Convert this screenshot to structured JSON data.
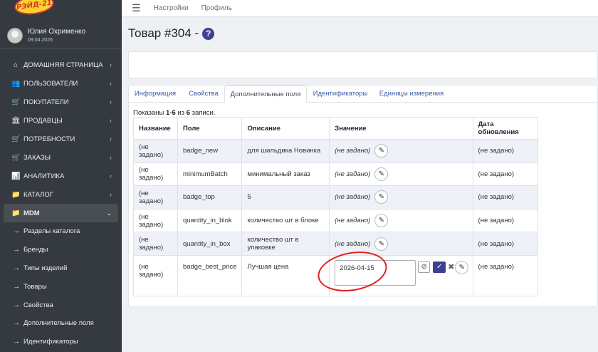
{
  "brand": {
    "logo_text": "РЭЙД-21"
  },
  "user": {
    "name": "Юлия Охрименко",
    "date": "09.04.2026"
  },
  "nav": [
    {
      "icon": "home-icon",
      "glyph": "⌂",
      "label": "ДОМАШНЯЯ СТРАНИЦА",
      "arrow": "‹"
    },
    {
      "icon": "users-icon",
      "glyph": "👥",
      "label": "ПОЛЬЗОВАТЕЛИ",
      "arrow": "‹"
    },
    {
      "icon": "cart-icon",
      "glyph": "🛒",
      "label": "ПОКУПАТЕЛИ",
      "arrow": "‹"
    },
    {
      "icon": "bank-icon",
      "glyph": "🏛",
      "label": "ПРОДАВЦЫ",
      "arrow": "‹"
    },
    {
      "icon": "cart-icon",
      "glyph": "🛒",
      "label": "ПОТРЕБНОСТИ",
      "arrow": "‹"
    },
    {
      "icon": "cart-icon",
      "glyph": "🛒",
      "label": "ЗАКАЗЫ",
      "arrow": "‹"
    },
    {
      "icon": "chart-icon",
      "glyph": "📊",
      "label": "АНАЛИТИКА",
      "arrow": "‹"
    },
    {
      "icon": "folder-icon",
      "glyph": "📁",
      "label": "КАТАЛОГ",
      "arrow": "‹"
    }
  ],
  "nav_active": {
    "icon": "folder-icon",
    "glyph": "📁",
    "label": "MDM",
    "arrow": "⌄"
  },
  "subnav": [
    {
      "label": "Разделы каталога"
    },
    {
      "label": "Бренды"
    },
    {
      "label": "Типы изделий"
    },
    {
      "label": "Товары"
    },
    {
      "label": "Свойства"
    },
    {
      "label": "Дополнительные поля"
    },
    {
      "label": "Идентификаторы"
    }
  ],
  "topbar": {
    "links": [
      "Настройки",
      "Профиль"
    ]
  },
  "page": {
    "title": "Товар #304 -",
    "help": "?"
  },
  "tabs": [
    "Информация",
    "Свойства",
    "Дополнительные поля",
    "Идентификаторы",
    "Единицы измерения"
  ],
  "summary": {
    "prefix": "Показаны ",
    "range": "1-6",
    "mid": " из ",
    "total": "6",
    "suffix": " записи."
  },
  "table": {
    "headers": [
      "Название",
      "Поле",
      "Описание",
      "Значение",
      "Дата обновления"
    ],
    "rows": [
      {
        "name": "(не задано)",
        "field": "badge_new",
        "desc": "для шильдика Новинка",
        "value": "(не задано)",
        "updated": "(не задано)"
      },
      {
        "name": "(не задано)",
        "field": "minimumBatch",
        "desc": "минимальный заказ",
        "value": "(не задано)",
        "updated": "(не задано)"
      },
      {
        "name": "(не задано)",
        "field": "badge_top",
        "desc": "5",
        "value": "(не задано)",
        "updated": "(не задано)"
      },
      {
        "name": "(не задано)",
        "field": "quantity_in_blok",
        "desc": "количество шт в блоке",
        "value": "(не задано)",
        "updated": "(не задано)"
      },
      {
        "name": "(не задано)",
        "field": "quantity_in_box",
        "desc": "количество шт в упаковке",
        "value": "(не задано)",
        "updated": "(не задано)"
      },
      {
        "name": "(не задано)",
        "field": "badge_best_price",
        "desc": "Лучшая цена",
        "value": "2026-04-15",
        "updated": "(не задано)"
      }
    ]
  },
  "colors": {
    "sidebar_bg": "#343a40",
    "accent": "#3d3f8f",
    "highlight": "#e0201d",
    "row_stripe": "#eef1f8"
  }
}
